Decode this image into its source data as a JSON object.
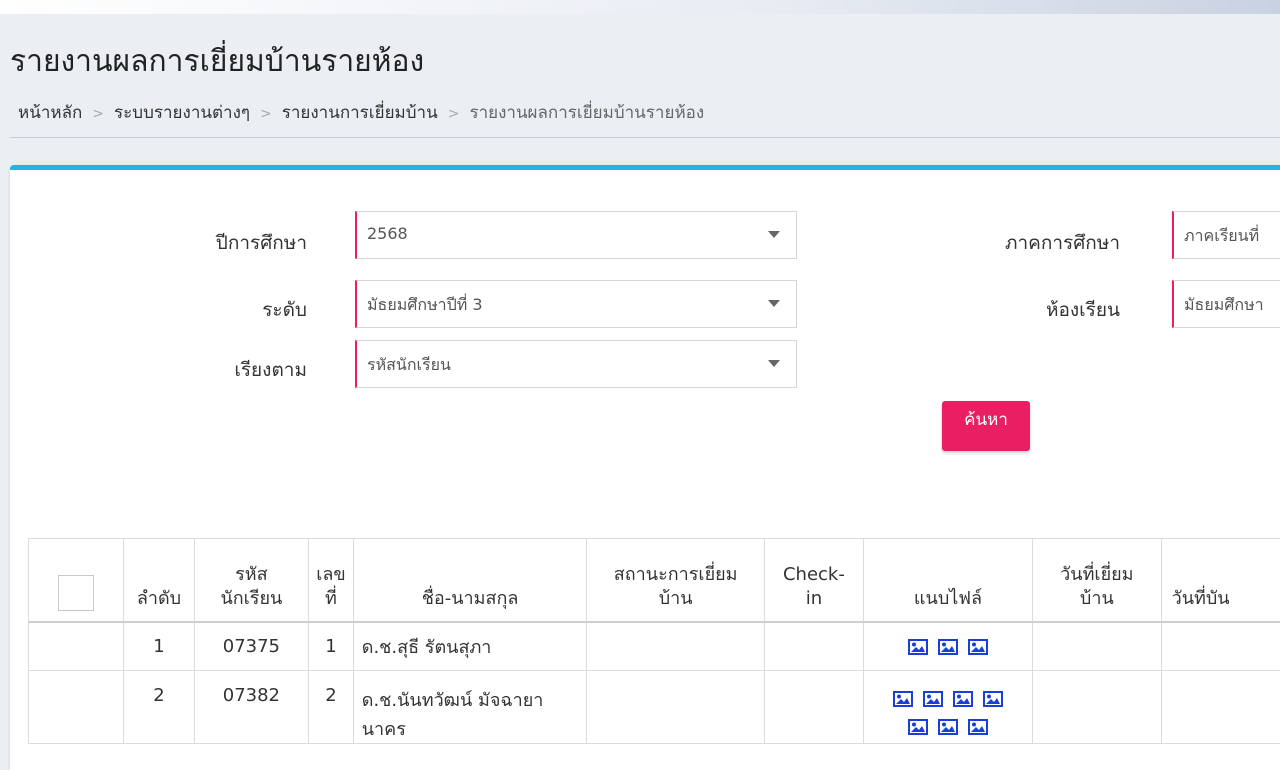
{
  "page": {
    "title": "รายงานผลการเยี่ยมบ้านรายห้อง",
    "breadcrumb": [
      "หน้าหลัก",
      "ระบบรายงานต่างๆ",
      "รายงานการเยี่ยมบ้าน",
      "รายงานผลการเยี่ยมบ้านรายห้อง"
    ],
    "breadcrumb_separator": ">"
  },
  "filters": {
    "year": {
      "label": "ปีการศึกษา",
      "value": "2568"
    },
    "semester": {
      "label": "ภาคการศึกษา",
      "value": "ภาคเรียนที่"
    },
    "level": {
      "label": "ระดับ",
      "value": "มัธยมศึกษาปีที่ 3"
    },
    "classroom": {
      "label": "ห้องเรียน",
      "value": "มัธยมศึกษา"
    },
    "sort": {
      "label": "เรียงตาม",
      "value": "รหัสนักเรียน"
    },
    "search_label": "ค้นหา"
  },
  "table": {
    "headers": {
      "order": "ลำดับ",
      "student_id": [
        "รหัส",
        "นักเรียน"
      ],
      "number": [
        "เลข",
        "ที่"
      ],
      "name": "ชื่อ-นามสกุล",
      "visit_status": [
        "สถานะการเยี่ยม",
        "บ้าน"
      ],
      "checkin": [
        "Check-",
        "in"
      ],
      "attachments": "แนบไฟล์",
      "visit_date": [
        "วันที่เยี่ยม",
        "บ้าน"
      ],
      "record_date": [
        "วันที่บัน",
        ""
      ]
    },
    "rows": [
      {
        "order": "1",
        "student_id": "07375",
        "number": "1",
        "name": "ด.ช.สุธี รัตนสุภา",
        "image_count": 3
      },
      {
        "order": "2",
        "student_id": "07382",
        "number": "2",
        "name": "ด.ช.นันทวัฒน์ มัจฉายา",
        "name_cont": "นาคร",
        "image_count": 7
      }
    ]
  },
  "colors": {
    "accent_top": "#1fb6e6",
    "button": "#e91e63",
    "icon": "#1a3fd9"
  },
  "icons": {
    "attachment": "image-icon",
    "dropdown": "caret-down-icon"
  }
}
